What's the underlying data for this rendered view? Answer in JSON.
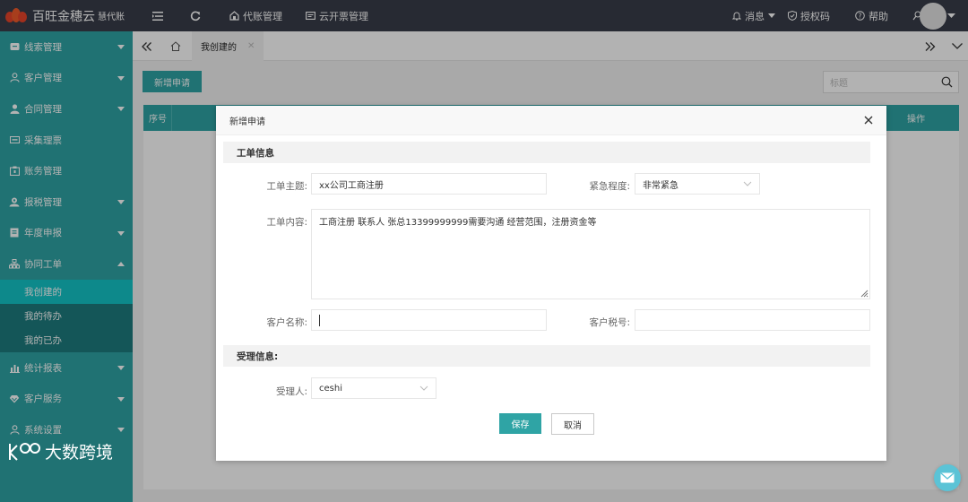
{
  "app": {
    "title": "百旺金穗云",
    "subtitle": "慧代账"
  },
  "topbar": {
    "menu_icon": "menu-collapse-icon",
    "refresh_icon": "refresh-icon",
    "nav": [
      {
        "label": "代账管理",
        "icon": "home-icon"
      },
      {
        "label": "云开票管理",
        "icon": "invoice-icon"
      }
    ],
    "messages": "消息",
    "license": "授权码",
    "help": "帮助"
  },
  "sidebar": {
    "items": [
      {
        "label": "线索管理",
        "icon": "lead-icon",
        "expanded": false
      },
      {
        "label": "客户管理",
        "icon": "customer-icon",
        "expanded": false
      },
      {
        "label": "合同管理",
        "icon": "contract-icon",
        "expanded": false
      },
      {
        "label": "采集理票",
        "icon": "ticket-icon",
        "expanded": false
      },
      {
        "label": "账务管理",
        "icon": "ledger-icon",
        "expanded": false
      },
      {
        "label": "报税管理",
        "icon": "tax-icon",
        "expanded": false
      },
      {
        "label": "年度申报",
        "icon": "annual-icon",
        "expanded": false
      },
      {
        "label": "协同工单",
        "icon": "workorder-icon",
        "expanded": true
      },
      {
        "label": "统计报表",
        "icon": "report-icon",
        "expanded": false
      },
      {
        "label": "客户服务",
        "icon": "service-icon",
        "expanded": false
      },
      {
        "label": "系统设置",
        "icon": "settings-icon",
        "expanded": false
      }
    ],
    "sub_items": [
      {
        "label": "我创建的",
        "active": true
      },
      {
        "label": "我的待办",
        "active": false
      },
      {
        "label": "我的已办",
        "active": false
      }
    ],
    "watermark": "大数跨境"
  },
  "tabs": {
    "active": "我创建的"
  },
  "main": {
    "add_button": "新增申请",
    "search_placeholder": "标题",
    "columns": [
      "序号",
      "操作"
    ]
  },
  "modal": {
    "title": "新增申请",
    "section1": "工单信息",
    "section2": "受理信息:",
    "fields": {
      "subject_label": "工单主题:",
      "subject_value": "xx公司工商注册",
      "urgency_label": "紧急程度:",
      "urgency_value": "非常紧急",
      "content_label": "工单内容:",
      "content_value": "工商注册  联系人 张总13399999999需要沟通 经营范围，注册资金等",
      "customer_label": "客户名称:",
      "customer_value": "",
      "tax_label": "客户税号:",
      "tax_value": "",
      "assignee_label": "受理人:",
      "assignee_value": "ceshi"
    },
    "save": "保存",
    "cancel": "取消"
  },
  "colors": {
    "accent": "#2fa4a5",
    "topbar": "#393d49",
    "submenu": "#1d7c7e",
    "submenu_active": "#13c4c8"
  }
}
